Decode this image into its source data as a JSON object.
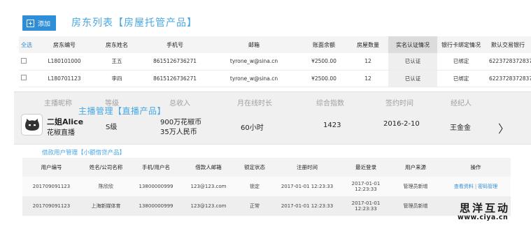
{
  "header": {
    "add_label": "添加",
    "title": "房东列表【房屋托管产品】"
  },
  "landlords": {
    "select_all": "全选",
    "columns": [
      "房东编号",
      "房东姓名",
      "手机号",
      "邮箱",
      "账面余额",
      "房屋数量",
      "实名认证情况",
      "银行卡绑定情况",
      "默认交易银行"
    ],
    "rows": [
      [
        "L180101000",
        "王五",
        "8615126736271",
        "tyrone_w@sina.cn",
        "¥2500.00",
        "12",
        "已认证",
        "已绑定",
        "6223728372837"
      ],
      [
        "L180701123",
        "李四",
        "8615126736271",
        "tyrone_w@sina.cn",
        "¥2500.00",
        "12",
        "已认证",
        "已绑定",
        "6223728372837"
      ]
    ]
  },
  "anchor": {
    "title": "主播管理【直播产品】",
    "columns": [
      "主播昵称",
      "等级",
      "总收入",
      "月在线时长",
      "综合指数",
      "签约时间",
      "经纪人"
    ],
    "row": {
      "name": "二姐Alice",
      "room": "花椒直播",
      "level": "S级",
      "income_line1": "900万花椒币",
      "income_line2": "35万人民币",
      "online": "60小时",
      "index": "1423",
      "sign_date": "2016-2-10",
      "agent": "王金金",
      "arrow": "〉"
    }
  },
  "loans": {
    "title": "借款用户管理【小额借贷产品】",
    "columns": [
      "用户编号",
      "姓名/公司名称",
      "手机/用户名",
      "借款人邮箱",
      "锁定状态",
      "注册时间",
      "最近登录",
      "用户来源",
      "操作"
    ],
    "rows": [
      {
        "id": "201709091123",
        "name": "陈欣欣",
        "phone": "13800000999",
        "email": "123@123.com",
        "status": "锁定",
        "reg": "2017-01-01 12:23:33",
        "last": "2017-01-01 12:23:33",
        "source": "管理员新增",
        "action_view": "查看资料",
        "action_sep": "|",
        "action_pwd": "密码管理"
      },
      {
        "id": "201709091123",
        "name": "上海新媒体育",
        "phone": "13800000999",
        "email": "123@123.com",
        "status": "正常",
        "reg": "2017-01-01 12:23:33",
        "last": "2017-01-01 12:23:33",
        "source": "管理员新增",
        "action_view": "",
        "action_sep": "",
        "action_pwd": ""
      }
    ]
  },
  "watermark": {
    "cn": "思洋互动",
    "url": "www.ciya.cn"
  },
  "colors": {
    "accent": "#2f8ed8",
    "title": "#49a8e6",
    "panel": "#f0f0f0"
  }
}
